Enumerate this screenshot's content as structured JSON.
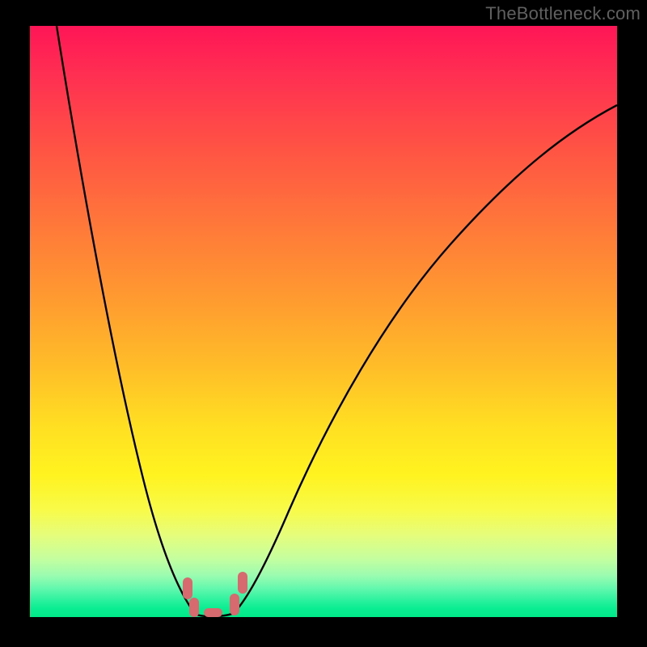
{
  "watermark": "TheBottleneck.com",
  "colors": {
    "page_bg": "#000000",
    "watermark_text": "#606060",
    "curve_stroke": "#000000",
    "marker_fill": "#d76a6e",
    "gradient_top": "#ff1556",
    "gradient_bottom": "#00e988"
  },
  "chart_data": {
    "type": "line",
    "title": "",
    "xlabel": "",
    "ylabel": "",
    "axes_visible": false,
    "grid": false,
    "legend": false,
    "x_range": [
      0,
      100
    ],
    "y_range": [
      0,
      100
    ],
    "note": "Axes are unlabeled; x and y are normalized 0–100 across the visible plot area. y=0 is the bottom (green) edge, y=100 is the top (red) edge.",
    "series": [
      {
        "name": "bottleneck-curve",
        "stroke": "#000000",
        "points": [
          {
            "x": 4.5,
            "y": 100.0
          },
          {
            "x": 8.0,
            "y": 78.0
          },
          {
            "x": 12.0,
            "y": 56.0
          },
          {
            "x": 18.0,
            "y": 30.0
          },
          {
            "x": 23.0,
            "y": 13.0
          },
          {
            "x": 26.5,
            "y": 3.0
          },
          {
            "x": 28.5,
            "y": 0.5
          },
          {
            "x": 31.5,
            "y": 0.3
          },
          {
            "x": 34.0,
            "y": 1.5
          },
          {
            "x": 38.0,
            "y": 7.0
          },
          {
            "x": 44.0,
            "y": 18.0
          },
          {
            "x": 52.0,
            "y": 33.0
          },
          {
            "x": 62.0,
            "y": 49.0
          },
          {
            "x": 72.0,
            "y": 63.0
          },
          {
            "x": 82.0,
            "y": 75.0
          },
          {
            "x": 92.0,
            "y": 83.0
          },
          {
            "x": 100.0,
            "y": 87.0
          }
        ]
      }
    ],
    "markers": [
      {
        "name": "marker-left-upper",
        "shape": "rounded-rect",
        "color": "#d76a6e",
        "x": 26.8,
        "y": 5.0
      },
      {
        "name": "marker-left-lower",
        "shape": "rounded-rect",
        "color": "#d76a6e",
        "x": 27.9,
        "y": 1.7
      },
      {
        "name": "marker-bottom",
        "shape": "rounded-rect",
        "color": "#d76a6e",
        "x": 31.2,
        "y": 0.7
      },
      {
        "name": "marker-right-lower",
        "shape": "rounded-rect",
        "color": "#d76a6e",
        "x": 34.8,
        "y": 2.1
      },
      {
        "name": "marker-right-upper",
        "shape": "rounded-rect",
        "color": "#d76a6e",
        "x": 36.2,
        "y": 5.8
      }
    ],
    "background": {
      "type": "vertical-gradient",
      "description": "Red (high/bad) at top transitioning through orange and yellow to green (low/good) at bottom.",
      "stops": [
        {
          "pos": 0.0,
          "color": "#ff1556"
        },
        {
          "pos": 0.33,
          "color": "#ff763a"
        },
        {
          "pos": 0.68,
          "color": "#ffe022"
        },
        {
          "pos": 0.86,
          "color": "#e6fd7a"
        },
        {
          "pos": 1.0,
          "color": "#00e988"
        }
      ]
    }
  }
}
